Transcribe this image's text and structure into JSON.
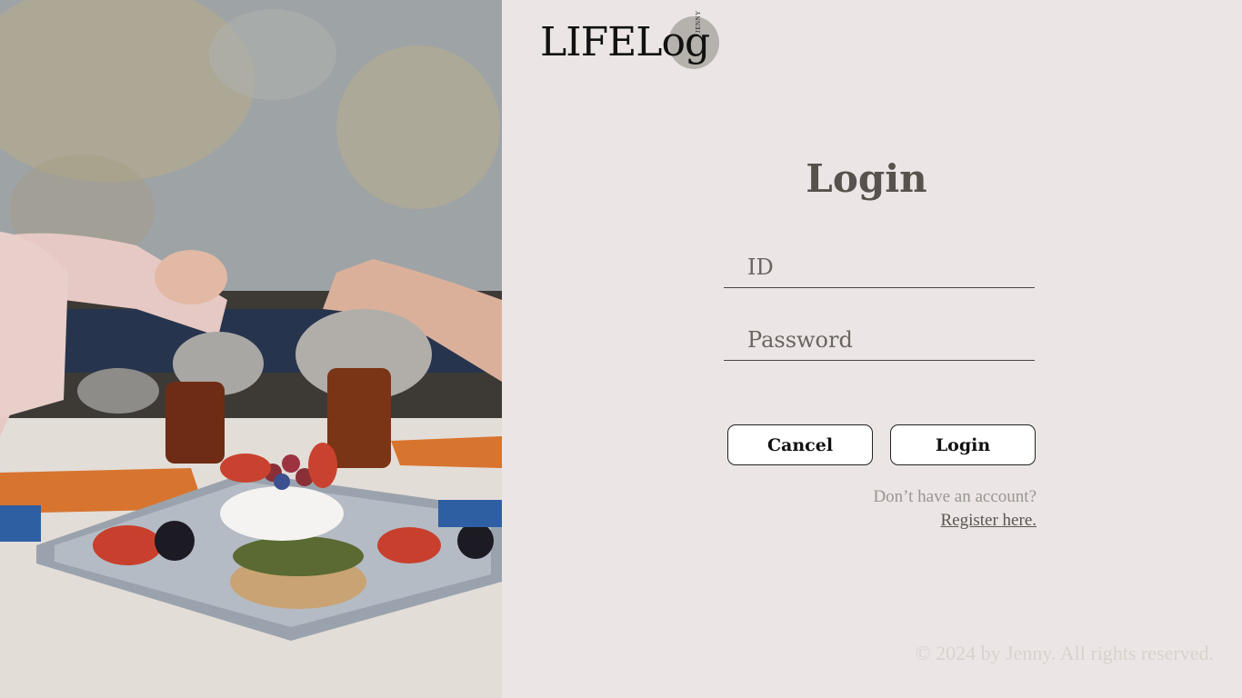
{
  "brand": {
    "logo_text": "LIFELog",
    "badge_text": "JENNY"
  },
  "login": {
    "title": "Login",
    "id_placeholder": "ID",
    "password_placeholder": "Password",
    "cancel_label": "Cancel",
    "login_label": "Login",
    "register_prompt": "Don’t have an account?",
    "register_link": "Register here."
  },
  "footer": {
    "copyright": "© 2024 by Jenny. All rights reserved."
  },
  "colors": {
    "background": "#ebe6e5",
    "title": "#57524d",
    "button_bg": "#ffffff",
    "badge": "#b5b1ad"
  }
}
